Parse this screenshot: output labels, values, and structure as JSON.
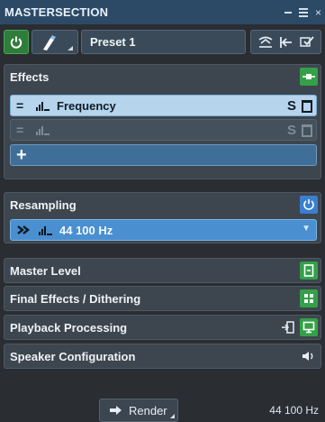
{
  "window": {
    "title": "MASTERSECTION"
  },
  "toolbar": {
    "preset_label": "Preset 1"
  },
  "effects": {
    "header": "Effects",
    "slots": [
      {
        "name": "Frequency",
        "state": "active"
      },
      {
        "name": "",
        "state": "empty"
      }
    ]
  },
  "resampling": {
    "header": "Resampling",
    "value": "44 100 Hz"
  },
  "sections": {
    "master_level": "Master Level",
    "final_effects": "Final Effects / Dithering",
    "playback": "Playback Processing",
    "speaker": "Speaker Configuration"
  },
  "footer": {
    "render_label": "Render",
    "sample_rate": "44 100 Hz"
  },
  "colors": {
    "title_bar": "#2c4a66",
    "green_accent": "#34a048",
    "blue_accent": "#3a7fd0",
    "active_slot": "#b6d4ec"
  }
}
